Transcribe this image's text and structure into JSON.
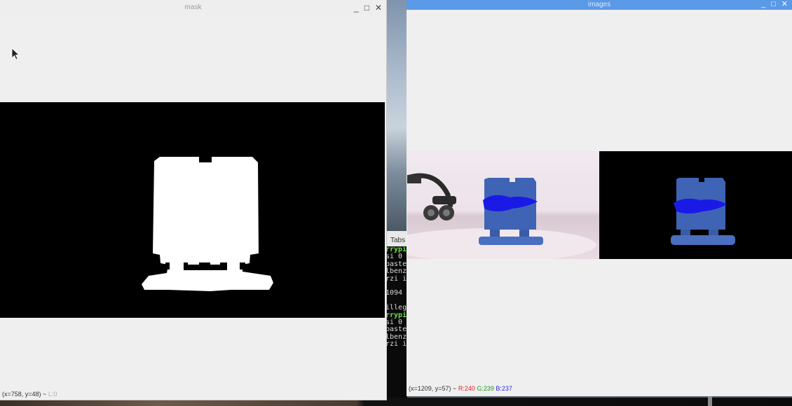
{
  "windows": {
    "mask": {
      "title": "mask",
      "controls": {
        "minimize": "_",
        "maximize": "□",
        "close": "✕"
      },
      "status": {
        "coords": "(x=758, y=48) ~",
        "level": "L:0"
      }
    },
    "images": {
      "title": "images",
      "controls": {
        "minimize": "_",
        "maximize": "□",
        "close": "✕"
      },
      "status": {
        "coords": "(x=1209, y=57) ~",
        "r": "R:240",
        "g": "G:239",
        "b": "B:237"
      }
    }
  },
  "terminal": {
    "tab": "Tabs",
    "lines": [
      {
        "text": "rrypi",
        "style": "prompt"
      },
      {
        "text": "si 0",
        "style": "plain"
      },
      {
        "text": "baste",
        "style": "plain"
      },
      {
        "text": "lbenz",
        "style": "plain"
      },
      {
        "text": "rzi i",
        "style": "plain"
      },
      {
        "text": "",
        "style": "plain"
      },
      {
        "text": "1094",
        "style": "plain"
      },
      {
        "text": "",
        "style": "plain"
      },
      {
        "text": "illeg",
        "style": "plain"
      },
      {
        "text": "rrypi",
        "style": "prompt"
      },
      {
        "text": "si 0",
        "style": "plain"
      },
      {
        "text": "baste",
        "style": "plain"
      },
      {
        "text": "lbenz",
        "style": "plain"
      },
      {
        "text": "rzi i",
        "style": "plain"
      }
    ]
  },
  "icons": [
    "mouse-cursor-icon",
    "minimize-icon",
    "maximize-icon",
    "close-icon"
  ],
  "colors": {
    "images_titlebar": "#5a9ae6",
    "object_blue": "#3f64b5",
    "marker_blue": "#1a1ae6"
  }
}
